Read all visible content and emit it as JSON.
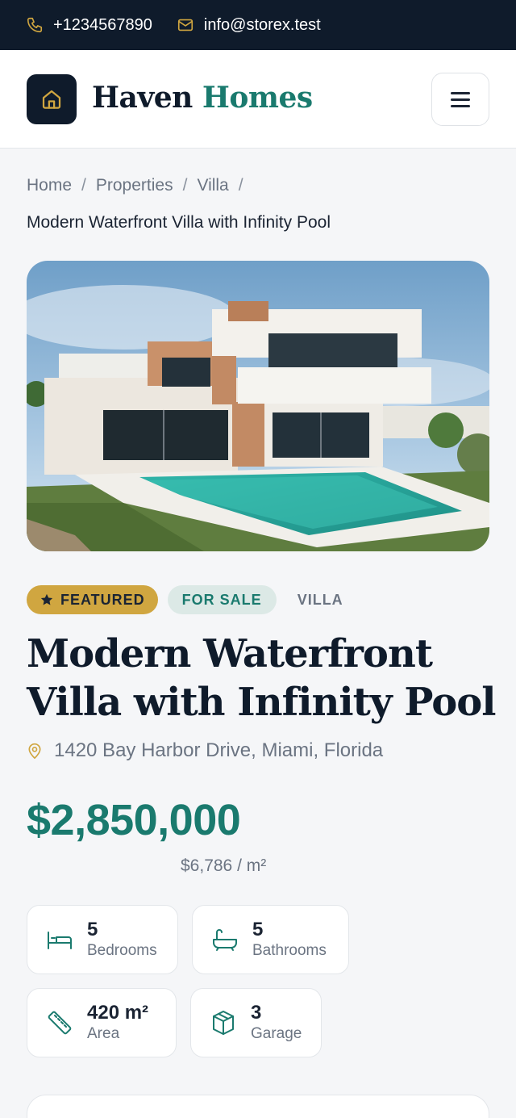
{
  "topbar": {
    "phone": "+1234567890",
    "email": "info@storex.test",
    "phone_icon": "phone-icon",
    "email_icon": "mail-icon"
  },
  "header": {
    "brand_first": "Haven",
    "brand_second": "Homes",
    "logo_icon": "home-icon",
    "menu_icon": "hamburger-menu-icon"
  },
  "breadcrumb": {
    "items": [
      "Home",
      "Properties",
      "Villa"
    ],
    "separator": "/",
    "current": "Modern Waterfront Villa with Infinity Pool"
  },
  "property": {
    "badges": {
      "featured": "FEATURED",
      "status": "FOR SALE",
      "type": "VILLA"
    },
    "title": "Modern Waterfront Villa with Infinity Pool",
    "address": "1420 Bay Harbor Drive, Miami, Florida",
    "price": "$2,850,000",
    "price_per_sqm": "$6,786 / m²",
    "features": [
      {
        "icon": "bed-icon",
        "value": "5",
        "label": "Bedrooms"
      },
      {
        "icon": "bathtub-icon",
        "value": "5",
        "label": "Bathrooms"
      },
      {
        "icon": "ruler-icon",
        "value": "420 m²",
        "label": "Area"
      },
      {
        "icon": "box-icon",
        "value": "3",
        "label": "Garage"
      }
    ]
  },
  "colors": {
    "navy": "#0f1b2b",
    "teal": "#1a7a6e",
    "gold": "#d0a640",
    "background": "#f5f6f8"
  }
}
